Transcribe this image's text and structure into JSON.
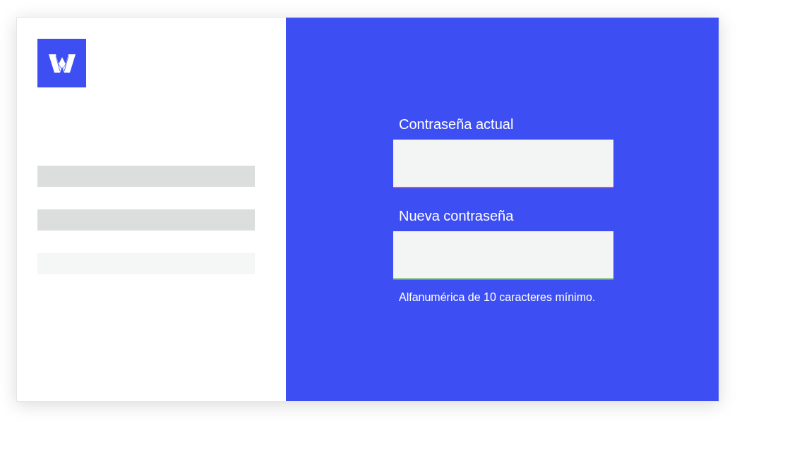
{
  "sidebar": {
    "placeholder_bars": [
      {
        "dimmed": false
      },
      {
        "dimmed": false
      },
      {
        "dimmed": true
      }
    ]
  },
  "form": {
    "fields": [
      {
        "label": "Contraseña actual",
        "valid": false
      },
      {
        "label": "Nueva contraseña",
        "valid": true,
        "hint": "Alfanumérica de 10 caracteres mínimo."
      }
    ]
  }
}
